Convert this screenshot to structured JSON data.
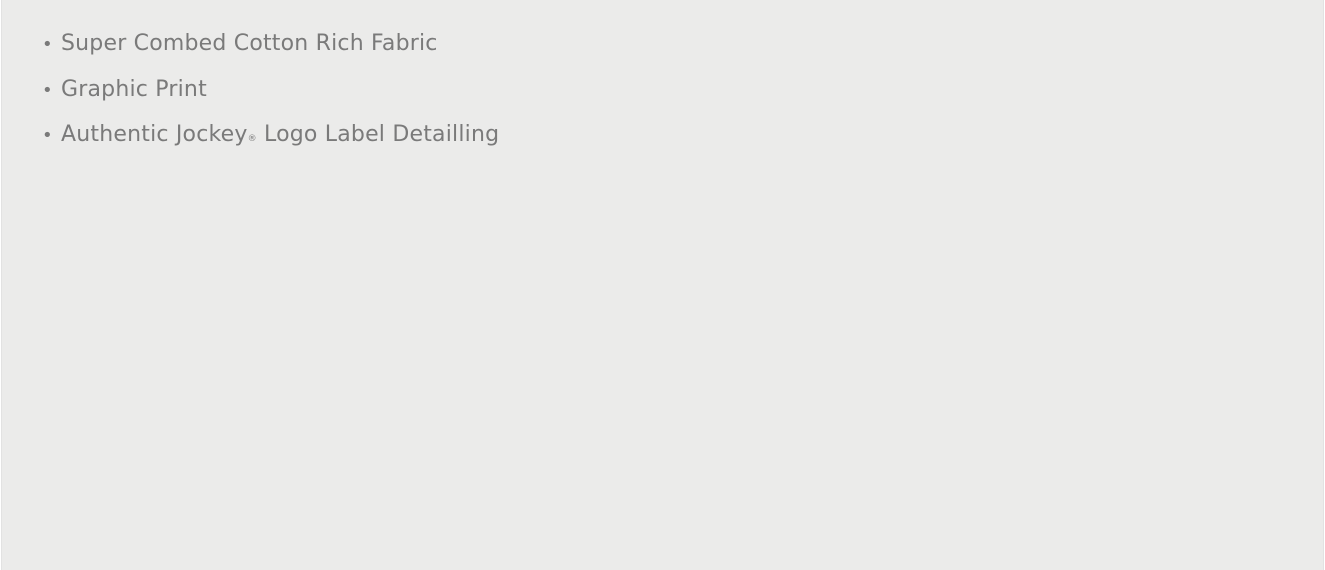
{
  "features": {
    "items": [
      {
        "label": "Super Combed Cotton Rich Fabric"
      },
      {
        "label": "Graphic Print"
      },
      {
        "label_before": "Authentic Jockey",
        "registered_mark": "®",
        "label_after": " Logo Label Detailling"
      }
    ],
    "bullet": "•"
  },
  "colors": {
    "background": "#ebebea",
    "text": "#7a7a7a"
  }
}
